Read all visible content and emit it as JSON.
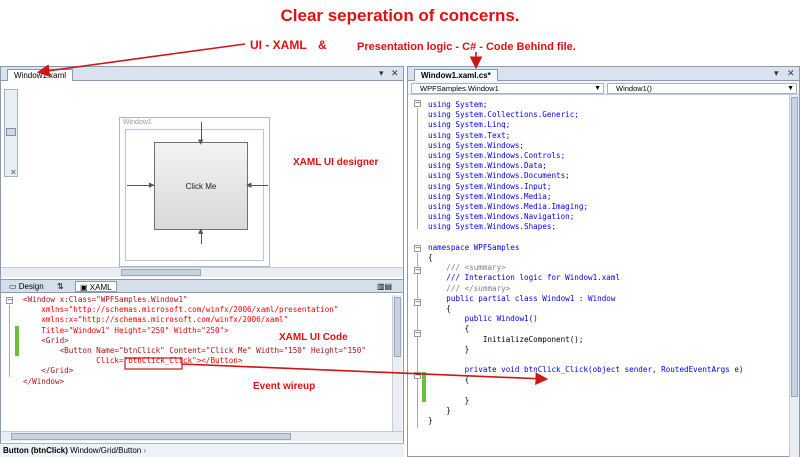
{
  "annotations": {
    "title": "Clear seperation of concerns.",
    "ui_xaml": "UI - XAML",
    "ampersand": "&",
    "presentation": "Presentation logic - C# - Code Behind file.",
    "designer_label": "XAML UI designer",
    "code_label": "XAML UI Code",
    "wireup_label": "Event wireup"
  },
  "left_pane": {
    "tab_label": "Window1.xaml",
    "tab_menu": "▾",
    "tab_close": "✕",
    "designer": {
      "window_title": "Window1",
      "button_text": "Click Me"
    },
    "split_tabs": [
      {
        "label": "Design",
        "icon": "design-icon"
      },
      {
        "label": "⇅",
        "icon": "swap-icon"
      },
      {
        "label": "XAML",
        "icon": "xaml-icon"
      }
    ],
    "xaml_lines": [
      "<Window x:Class=\"WPFSamples.Window1\"",
      "    xmlns=\"http://schemas.microsoft.com/winfx/2006/xaml/presentation\"",
      "    xmlns:x=\"http://schemas.microsoft.com/winfx/2006/xaml\"",
      "    Title=\"Window1\" Height=\"250\" Width=\"250\">",
      "    <Grid>",
      "        <Button Name=\"btnClick\" Content=\"Click Me\" Width=\"150\" Height=\"150\"",
      "                Click=\"btnClick_Click\"></Button>",
      "    </Grid>",
      "</Window>"
    ],
    "status": {
      "selected": "Button (btnClick)",
      "path": "Window/Grid/Button"
    }
  },
  "right_pane": {
    "tab_label": "Window1.xaml.cs*",
    "tab_menu": "▾",
    "tab_close": "✕",
    "type_combo": "WPFSamples.Window1",
    "member_combo": "Window1()",
    "usings": [
      "using System;",
      "using System.Collections.Generic;",
      "using System.Linq;",
      "using System.Text;",
      "using System.Windows;",
      "using System.Windows.Controls;",
      "using System.Windows.Data;",
      "using System.Windows.Documents;",
      "using System.Windows.Input;",
      "using System.Windows.Media;",
      "using System.Windows.Media.Imaging;",
      "using System.Windows.Navigation;",
      "using System.Windows.Shapes;"
    ],
    "ns_line": "namespace WPFSamples",
    "open_brace": "{",
    "summary_open": "/// <summary>",
    "summary_text": "/// Interaction logic for Window1.xaml",
    "summary_close": "/// </summary>",
    "class_line": "public partial class Window1 : Window",
    "class_open": "{",
    "ctor_line": "public Window1()",
    "ctor_open": "{",
    "init_line": "InitializeComponent();",
    "ctor_close": "}",
    "handler_line": "private void btnClick_Click(object sender, RoutedEventArgs e)",
    "handler_open": "{",
    "handler_close": "}",
    "class_close": "}",
    "ns_close": "}"
  }
}
